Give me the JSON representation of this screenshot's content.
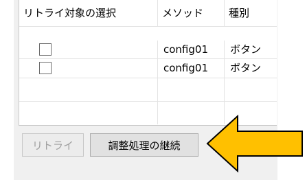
{
  "table": {
    "headers": [
      "リトライ対象の選択",
      "メソッド",
      "種別"
    ],
    "rows": [
      {
        "checked": false,
        "method": "config01",
        "type": "ボタン"
      },
      {
        "checked": false,
        "method": "config01",
        "type": "ボタン"
      }
    ]
  },
  "buttons": {
    "retry_label": "リトライ",
    "continue_label": "調整処理の継続"
  },
  "annotation": {
    "icon": "arrow-left-icon",
    "fill_color": "#FFC000",
    "stroke_color": "#000000"
  }
}
